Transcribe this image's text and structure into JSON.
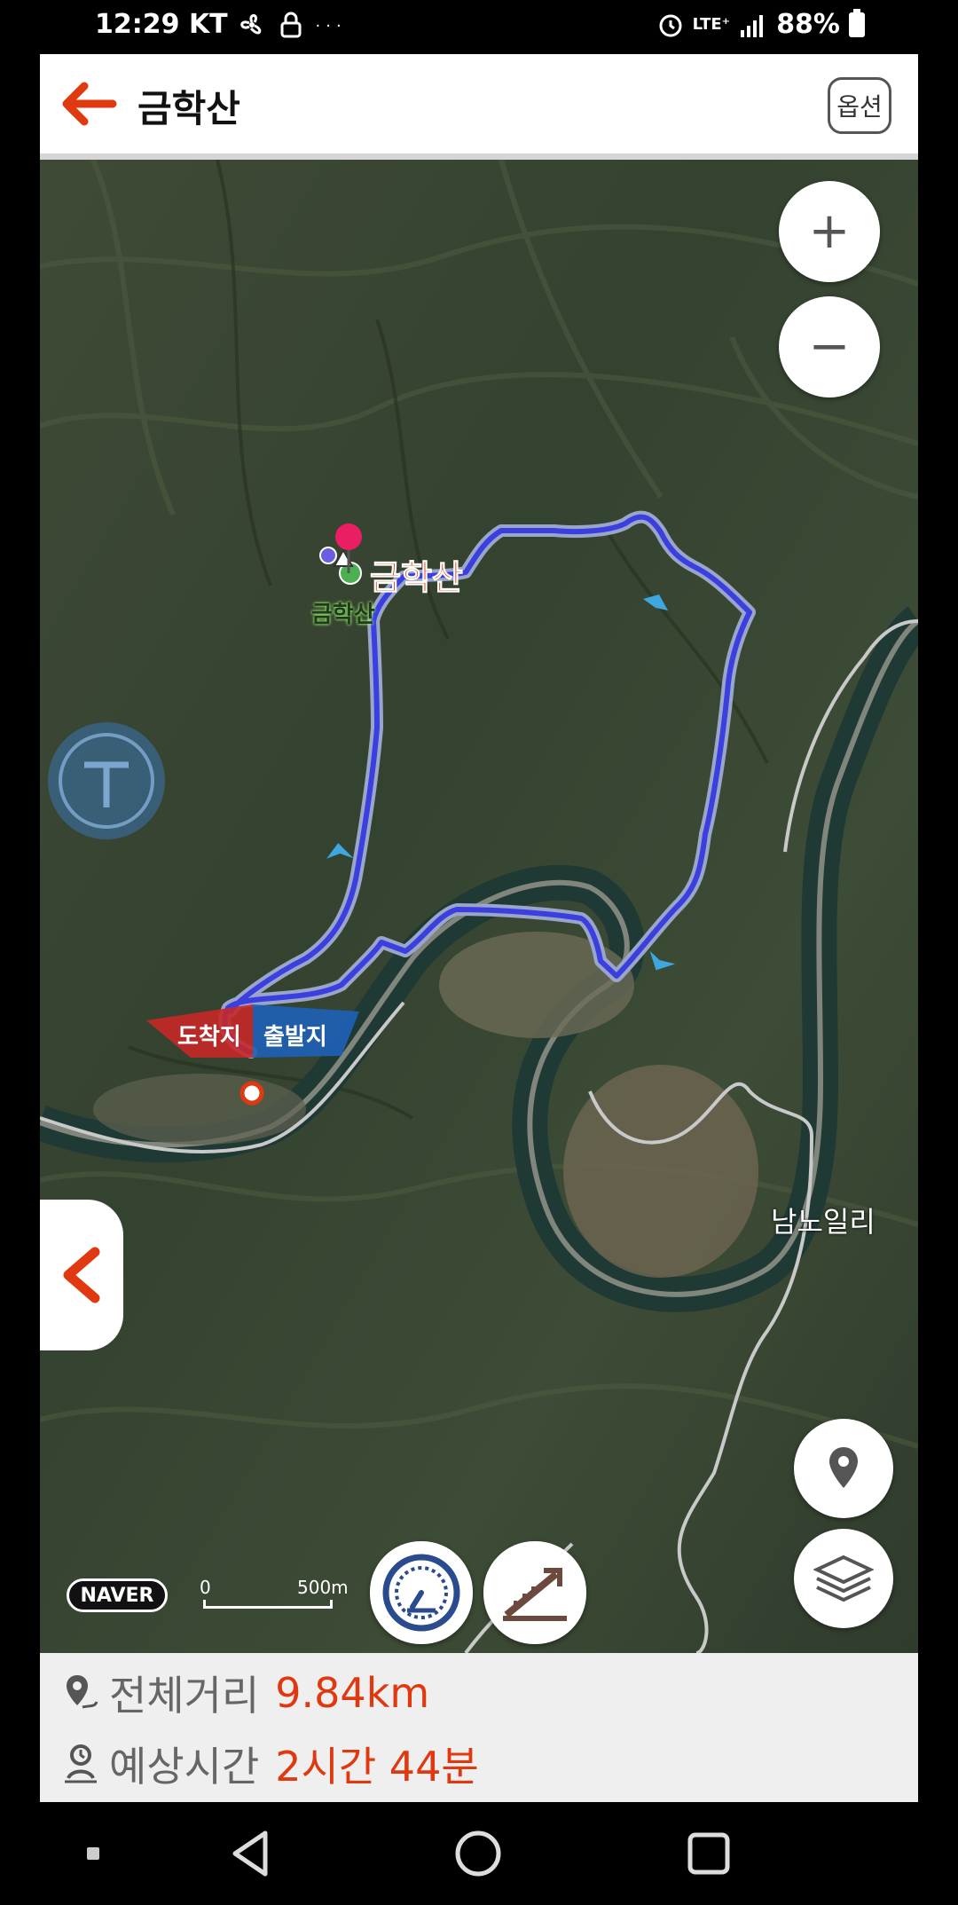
{
  "status_bar": {
    "time": "12:29 KT",
    "left_icons": [
      "fan-icon",
      "lock-icon",
      "more-dots-icon"
    ],
    "overflow_text": "···",
    "network": "LTE⁺",
    "battery": "88%"
  },
  "header": {
    "title": "금학산",
    "option_label": "옵션",
    "accent": "#e0380f"
  },
  "map": {
    "peak_label": "금학산",
    "peak_label_small": "금학산",
    "region_label": "남노일리",
    "arrival_label": "도착지",
    "departure_label": "출발지",
    "provider": "NAVER",
    "scale_zero": "0",
    "scale_distance": "500m",
    "route_color": "#3b3fe0",
    "zoom_in_label": "+",
    "zoom_out_label": "−"
  },
  "info": {
    "distance_label": "전체거리",
    "distance_value": "9.84km",
    "time_label": "예상시간",
    "time_value": "2시간 44분",
    "value_color": "#e0380f"
  }
}
